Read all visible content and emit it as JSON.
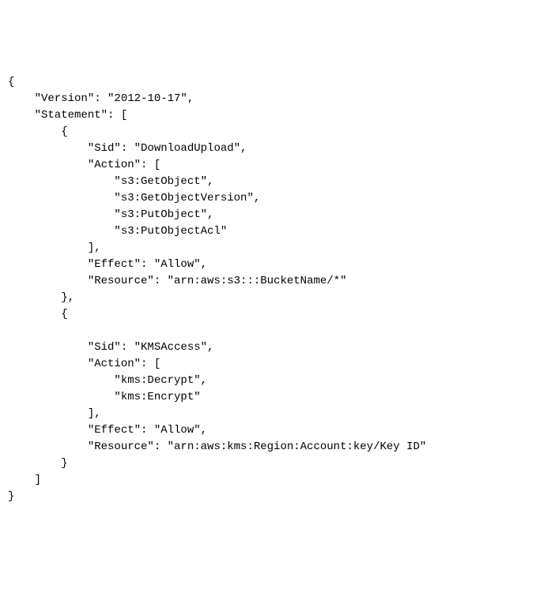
{
  "policy": {
    "open_brace": "{",
    "version_line": "    \"Version\": \"2012-10-17\",",
    "statement_open": "    \"Statement\": [",
    "stmt1_open": "        {",
    "stmt1_sid": "            \"Sid\": \"DownloadUpload\",",
    "stmt1_action_open": "            \"Action\": [",
    "stmt1_action1": "                \"s3:GetObject\",",
    "stmt1_action2": "                \"s3:GetObjectVersion\",",
    "stmt1_action3": "                \"s3:PutObject\",",
    "stmt1_action4": "                \"s3:PutObjectAcl\"",
    "stmt1_action_close": "            ],",
    "stmt1_effect": "            \"Effect\": \"Allow\",",
    "stmt1_resource": "            \"Resource\": \"arn:aws:s3:::BucketName/*\"",
    "stmt1_close": "        },",
    "stmt2_open": "        {",
    "blank": "",
    "stmt2_sid": "            \"Sid\": \"KMSAccess\",",
    "stmt2_action_open": "            \"Action\": [",
    "stmt2_action1": "                \"kms:Decrypt\",",
    "stmt2_action2": "                \"kms:Encrypt\"",
    "stmt2_action_close": "            ],",
    "stmt2_effect": "            \"Effect\": \"Allow\",",
    "stmt2_resource": "            \"Resource\": \"arn:aws:kms:Region:Account:key/Key ID\"",
    "stmt2_close": "        }",
    "statement_close": "    ]",
    "close_brace": "}"
  }
}
